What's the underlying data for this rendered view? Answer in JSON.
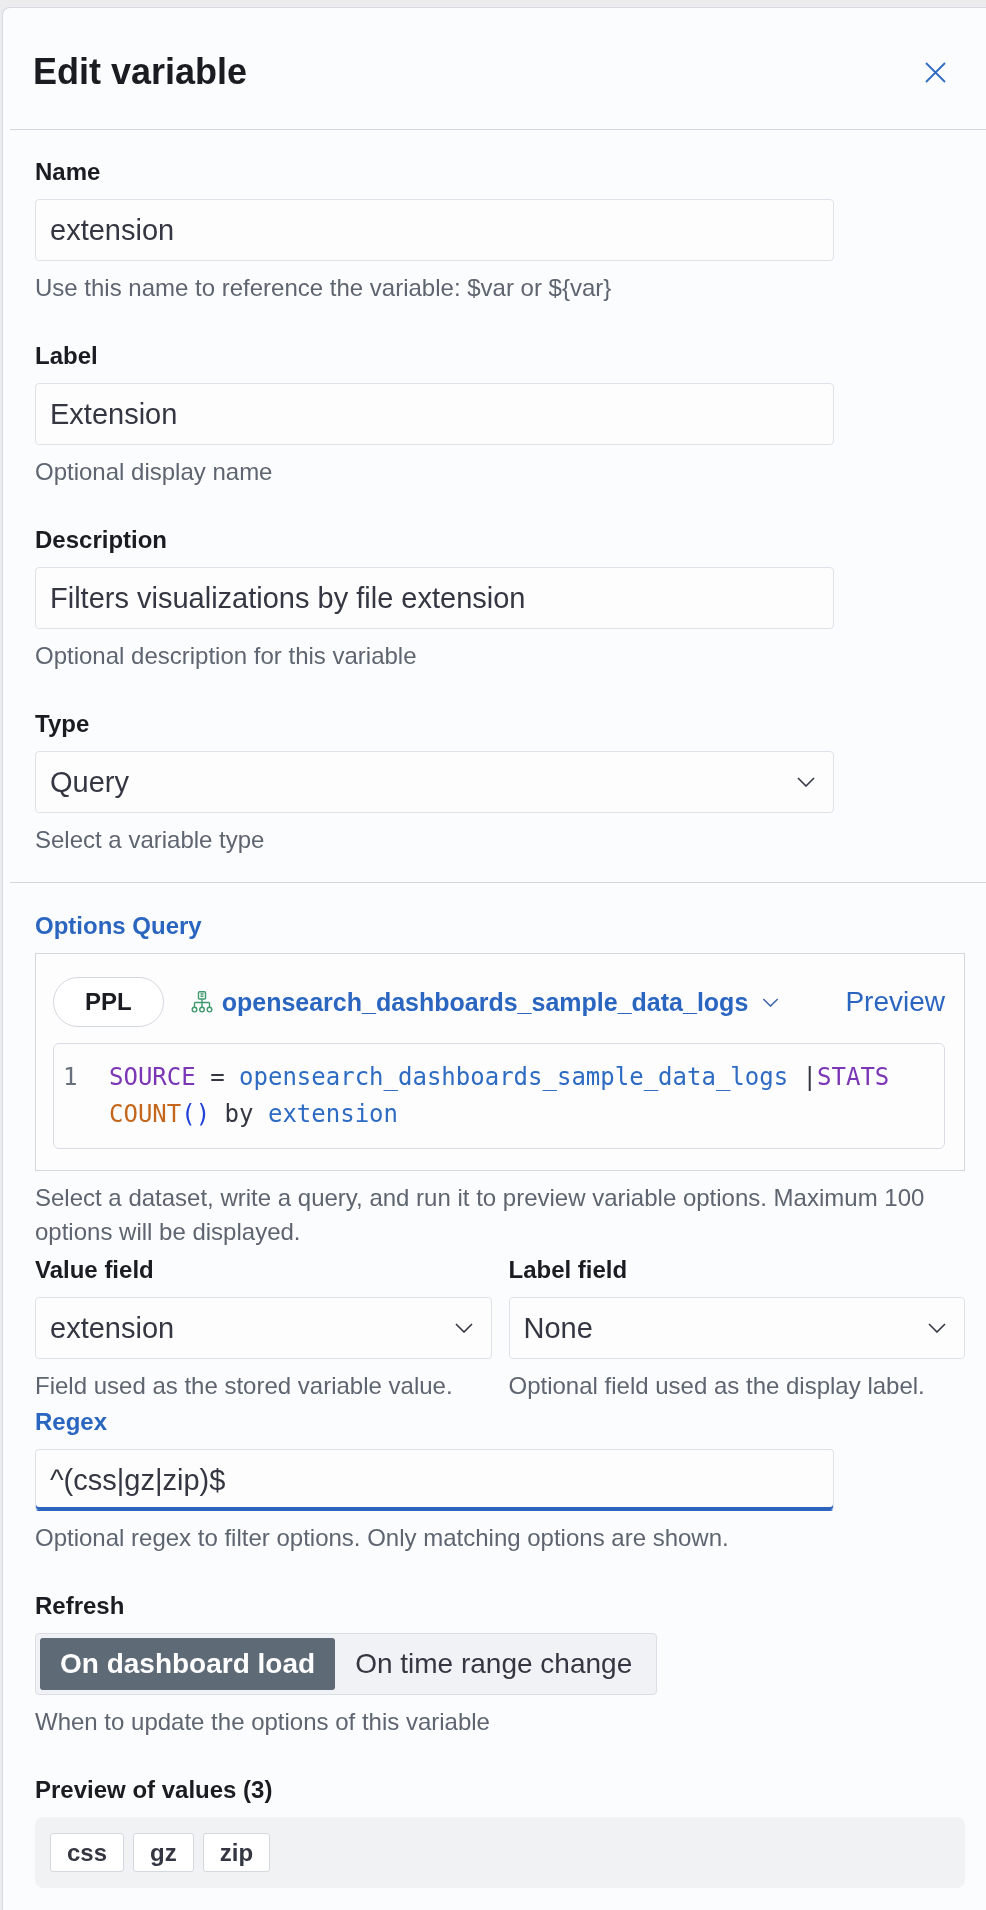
{
  "flyout": {
    "title": "Edit variable"
  },
  "fields": [
    {
      "kind": "text",
      "label": "Name",
      "value": "extension",
      "help": "Use this name to reference the variable: $var or ${var}",
      "focused": false
    },
    {
      "kind": "text",
      "label": "Label",
      "value": "Extension",
      "help": "Optional display name",
      "focused": false
    },
    {
      "kind": "text",
      "label": "Description",
      "value": "Filters visualizations by file extension",
      "help": "Optional description for this variable",
      "focused": false
    },
    {
      "kind": "select",
      "label": "Type",
      "value": "Query",
      "help": "Select a variable type",
      "focused": false
    }
  ],
  "options_query": {
    "label": "Options Query",
    "focused": true,
    "language": "PPL",
    "dataset": "opensearch_dashboards_sample_data_logs",
    "action": "Preview",
    "lines": [
      {
        "number": "1",
        "tokens": [
          {
            "kind": "keyword",
            "text": "SOURCE"
          },
          {
            "kind": "operator",
            "text": " = "
          },
          {
            "kind": "identifier",
            "text": "opensearch_dashboards_sample_data_logs"
          },
          {
            "kind": "operator",
            "text": " |"
          },
          {
            "kind": "keyword",
            "text": "STATS "
          },
          {
            "kind": "function",
            "text": "COUNT"
          },
          {
            "kind": "paren",
            "text": "()"
          },
          {
            "kind": "operator",
            "text": " by "
          },
          {
            "kind": "identifier",
            "text": "extension"
          }
        ]
      }
    ],
    "help": "Select a dataset, write a query, and run it to preview variable options. Maximum 100 options will be displayed."
  },
  "field_pickers": [
    {
      "kind": "select",
      "label": "Value field",
      "value": "extension",
      "help": "Field used as the stored variable value.",
      "focused": false
    },
    {
      "kind": "select",
      "label": "Label field",
      "value": "None",
      "help": "Optional field used as the display label.",
      "focused": false
    }
  ],
  "regex": {
    "kind": "text",
    "label": "Regex",
    "value": "^(css|gz|zip)$",
    "help": "Optional regex to filter options. Only matching options are shown.",
    "focused": true
  },
  "refresh": {
    "label": "Refresh",
    "options": [
      {
        "label": "On dashboard load",
        "selected": true
      },
      {
        "label": "On time range change",
        "selected": false
      }
    ],
    "help": "When to update the options of this variable"
  },
  "preview": {
    "label": "Preview of values (3)",
    "values": [
      "css",
      "gz",
      "zip"
    ]
  }
}
